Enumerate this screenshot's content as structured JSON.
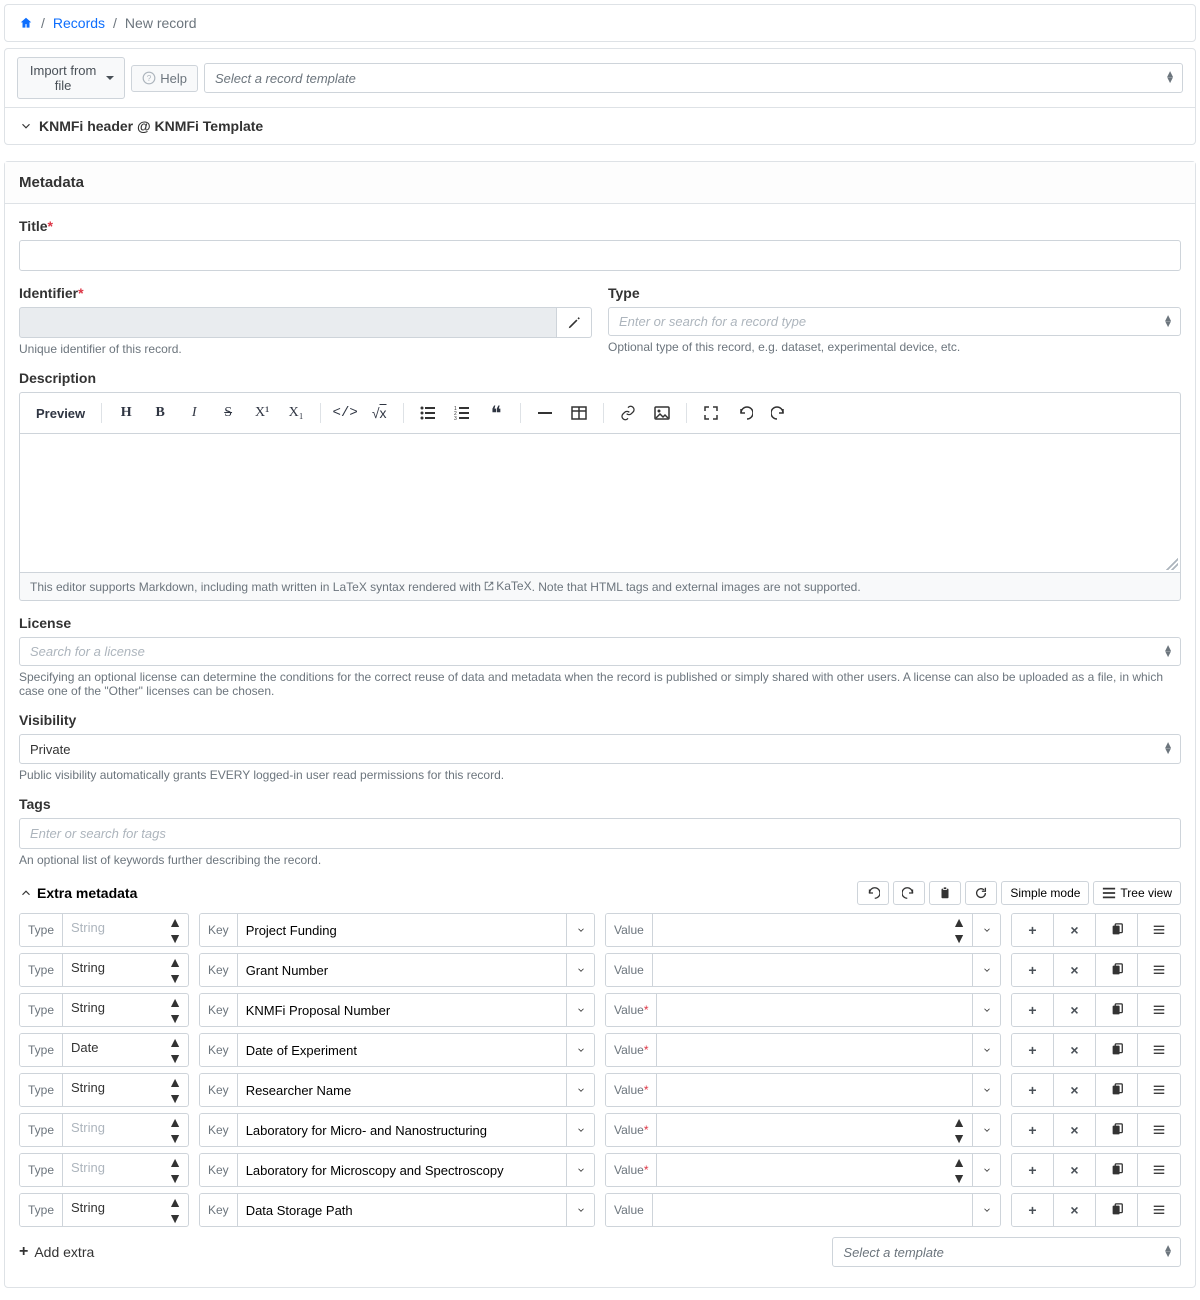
{
  "breadcrumb": {
    "records": "Records",
    "new_record": "New record"
  },
  "toolbar": {
    "import": "Import from file",
    "help": "Help",
    "template_placeholder": "Select a record template"
  },
  "template_header": "KNMFi header @ KNMFi Template",
  "panel": {
    "metadata": "Metadata"
  },
  "fields": {
    "title_label": "Title",
    "identifier_label": "Identifier",
    "identifier_help": "Unique identifier of this record.",
    "type_label": "Type",
    "type_placeholder": "Enter or search for a record type",
    "type_help": "Optional type of this record, e.g. dataset, experimental device, etc.",
    "description_label": "Description",
    "editor_footer_pre": "This editor supports Markdown, including math written in LaTeX syntax rendered with ",
    "editor_footer_link": "KaTeX",
    "editor_footer_post": ". Note that HTML tags and external images are not supported.",
    "preview": "Preview",
    "license_label": "License",
    "license_placeholder": "Search for a license",
    "license_help": "Specifying an optional license can determine the conditions for the correct reuse of data and metadata when the record is published or simply shared with other users. A license can also be uploaded as a file, in which case one of the \"Other\" licenses can be chosen.",
    "visibility_label": "Visibility",
    "visibility_value": "Private",
    "visibility_help": "Public visibility automatically grants EVERY logged-in user read permissions for this record.",
    "tags_label": "Tags",
    "tags_placeholder": "Enter or search for tags",
    "tags_help": "An optional list of keywords further describing the record."
  },
  "extra": {
    "title": "Extra metadata",
    "simple_mode": "Simple mode",
    "tree_view": "Tree view",
    "type_label": "Type",
    "key_label": "Key",
    "value_label": "Value",
    "value_req": "Value*",
    "add_extra": "Add extra",
    "select_template": "Select a template",
    "rows": [
      {
        "type": "String",
        "type_locked": true,
        "key": "Project Funding",
        "req": false,
        "updown": true
      },
      {
        "type": "String",
        "type_locked": false,
        "key": "Grant Number",
        "req": false,
        "updown": false
      },
      {
        "type": "String",
        "type_locked": false,
        "key": "KNMFi Proposal Number",
        "req": true,
        "updown": false
      },
      {
        "type": "Date",
        "type_locked": false,
        "key": "Date of Experiment",
        "req": true,
        "updown": false
      },
      {
        "type": "String",
        "type_locked": false,
        "key": "Researcher Name",
        "req": true,
        "updown": false
      },
      {
        "type": "String",
        "type_locked": true,
        "key": "Laboratory for Micro- and Nanostructuring",
        "req": true,
        "updown": true
      },
      {
        "type": "String",
        "type_locked": true,
        "key": "Laboratory for Microscopy and Spectroscopy",
        "req": true,
        "updown": true
      },
      {
        "type": "String",
        "type_locked": false,
        "key": "Data Storage Path",
        "req": false,
        "updown": false
      }
    ]
  }
}
